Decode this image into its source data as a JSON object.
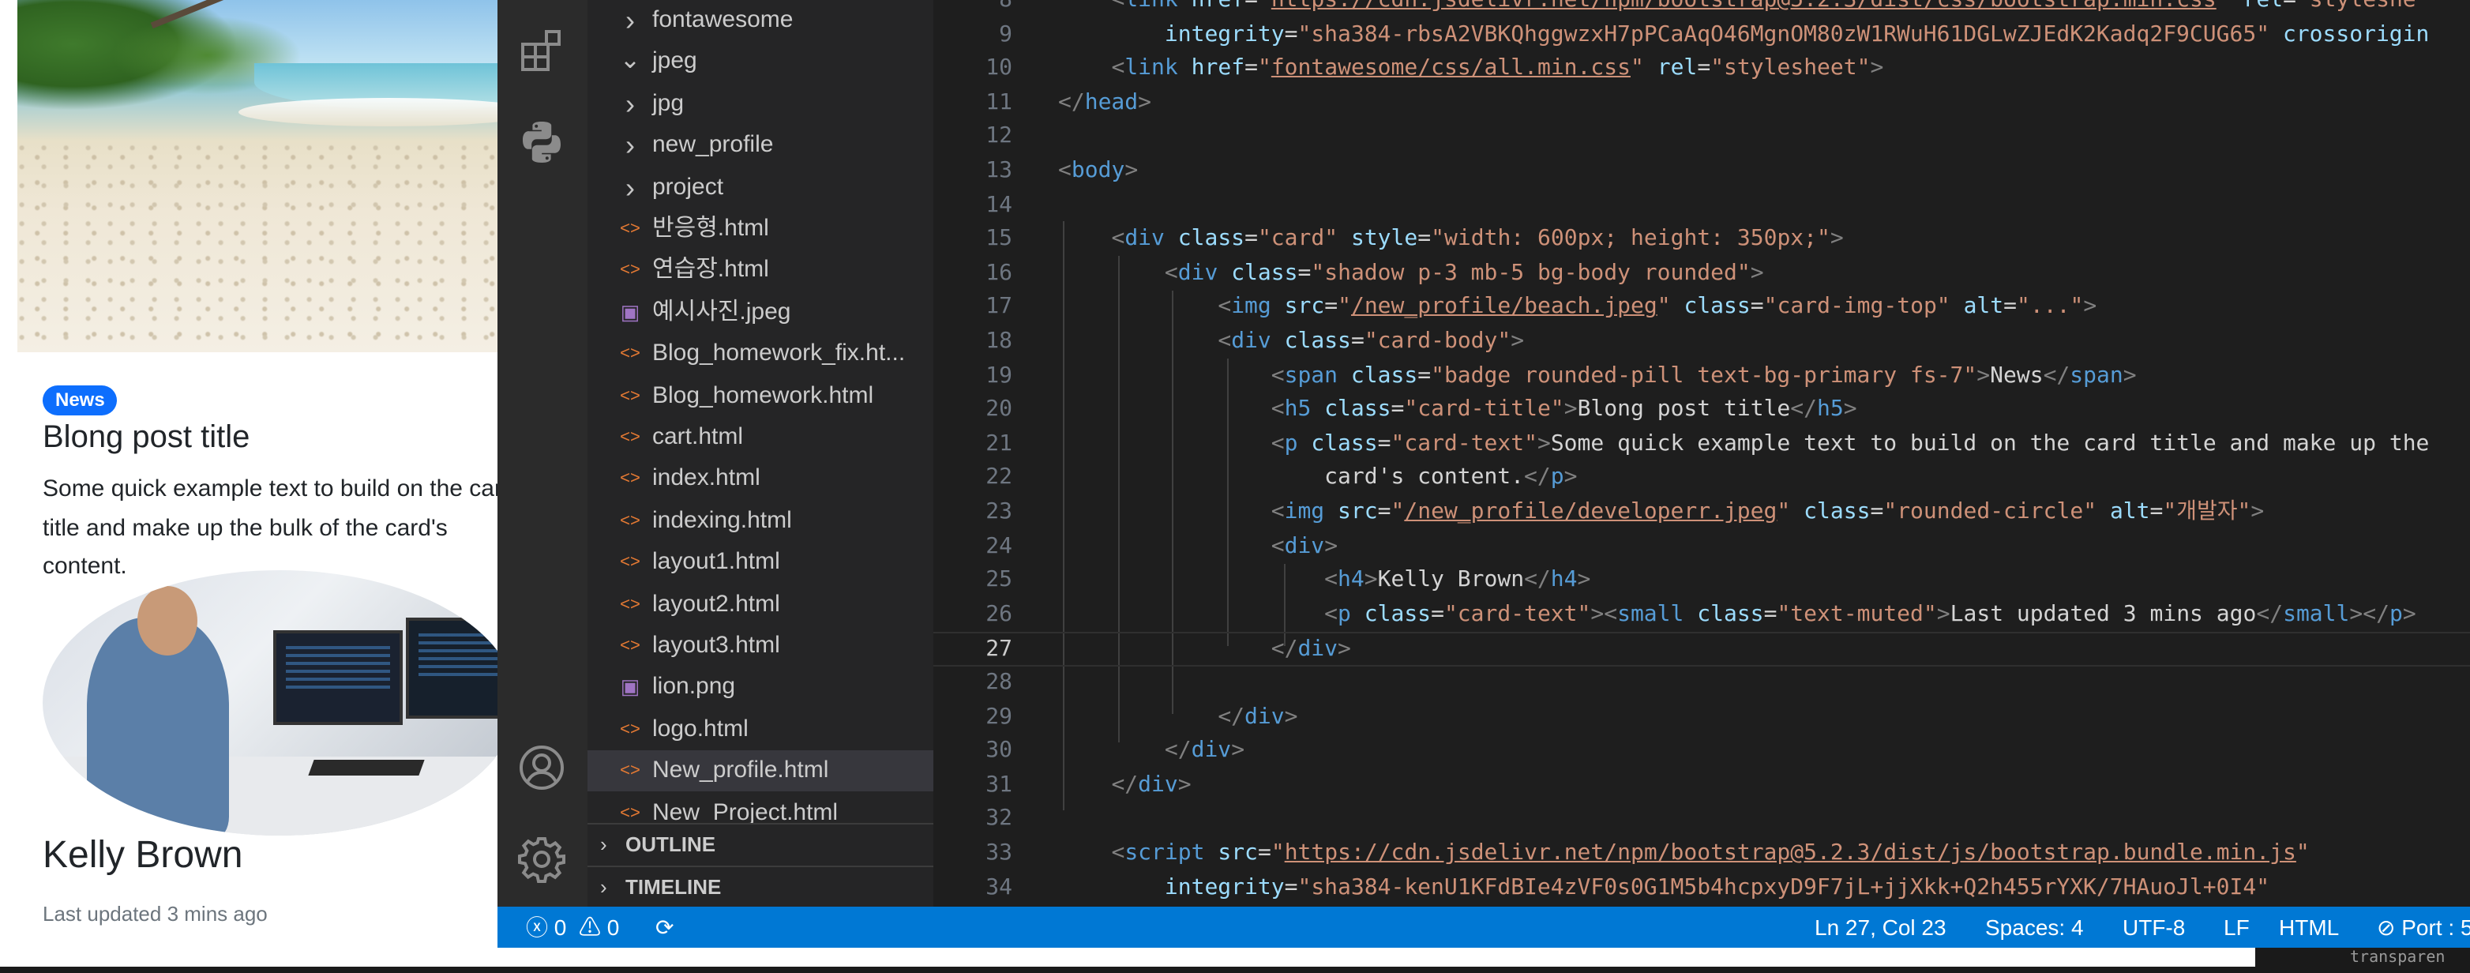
{
  "preview": {
    "badge": "News",
    "title": "Blong post title",
    "text": "Some quick example text to build on the card title and make up the bulk of the card's content.",
    "name": "Kelly Brown",
    "updated": "Last updated 3 mins ago"
  },
  "activity_icons": [
    "extensions-icon",
    "python-icon",
    "account-icon",
    "settings-gear-icon"
  ],
  "explorer": {
    "files": [
      {
        "label": "fontawesome",
        "type": "folder-closed"
      },
      {
        "label": "jpeg",
        "type": "folder-open"
      },
      {
        "label": "jpg",
        "type": "folder-closed"
      },
      {
        "label": "new_profile",
        "type": "folder-closed"
      },
      {
        "label": "project",
        "type": "folder-closed"
      },
      {
        "label": "반응형.html",
        "type": "html"
      },
      {
        "label": "연습장.html",
        "type": "html"
      },
      {
        "label": "예시사진.jpeg",
        "type": "image"
      },
      {
        "label": "Blog_homework_fix.ht...",
        "type": "html"
      },
      {
        "label": "Blog_homework.html",
        "type": "html"
      },
      {
        "label": "cart.html",
        "type": "html"
      },
      {
        "label": "index.html",
        "type": "html"
      },
      {
        "label": "indexing.html",
        "type": "html"
      },
      {
        "label": "layout1.html",
        "type": "html"
      },
      {
        "label": "layout2.html",
        "type": "html"
      },
      {
        "label": "layout3.html",
        "type": "html"
      },
      {
        "label": "lion.png",
        "type": "image"
      },
      {
        "label": "logo.html",
        "type": "html"
      },
      {
        "label": "New_profile.html",
        "type": "html",
        "selected": true
      },
      {
        "label": "New_Project.html",
        "type": "html"
      }
    ],
    "outline": "OUTLINE",
    "timeline": "TIMELINE"
  },
  "editor": {
    "current_line": 27,
    "lines": [
      {
        "n": "8",
        "segs": [
          [
            "i",
            "    "
          ],
          [
            "br",
            "<"
          ],
          [
            "tag",
            "link "
          ],
          [
            "attr",
            "href"
          ],
          [
            "eq",
            "="
          ],
          [
            "str",
            "\""
          ],
          [
            "url",
            "https://cdn.jsdelivr.net/npm/bootstrap@5.2.3/dist/css/bootstrap.min.css"
          ],
          [
            "str",
            "\""
          ],
          [
            "eq",
            " "
          ],
          [
            "attr",
            "rel"
          ],
          [
            "eq",
            "="
          ],
          [
            "str",
            "\"styleshe"
          ]
        ]
      },
      {
        "n": "9",
        "segs": [
          [
            "i",
            "        "
          ],
          [
            "attr",
            "integrity"
          ],
          [
            "eq",
            "="
          ],
          [
            "str",
            "\"sha384-rbsA2VBKQhggwzxH7pPCaAqO46MgnOM80zW1RWuH61DGLwZJEdK2Kadq2F9CUG65\""
          ],
          [
            "eq",
            " "
          ],
          [
            "attr",
            "crossorigin"
          ]
        ]
      },
      {
        "n": "10",
        "segs": [
          [
            "i",
            "    "
          ],
          [
            "br",
            "<"
          ],
          [
            "tag",
            "link "
          ],
          [
            "attr",
            "href"
          ],
          [
            "eq",
            "="
          ],
          [
            "str",
            "\""
          ],
          [
            "url",
            "fontawesome/css/all.min.css"
          ],
          [
            "str",
            "\""
          ],
          [
            "eq",
            " "
          ],
          [
            "attr",
            "rel"
          ],
          [
            "eq",
            "="
          ],
          [
            "str",
            "\"stylesheet\""
          ],
          [
            "br",
            ">"
          ]
        ]
      },
      {
        "n": "11",
        "segs": [
          [
            "br",
            "</"
          ],
          [
            "tag",
            "head"
          ],
          [
            "br",
            ">"
          ]
        ]
      },
      {
        "n": "12",
        "segs": []
      },
      {
        "n": "13",
        "segs": [
          [
            "br",
            "<"
          ],
          [
            "tag",
            "body"
          ],
          [
            "br",
            ">"
          ]
        ]
      },
      {
        "n": "14",
        "segs": []
      },
      {
        "n": "15",
        "segs": [
          [
            "i",
            "    "
          ],
          [
            "br",
            "<"
          ],
          [
            "tag",
            "div "
          ],
          [
            "attr",
            "class"
          ],
          [
            "eq",
            "="
          ],
          [
            "str",
            "\"card\""
          ],
          [
            "eq",
            " "
          ],
          [
            "attr",
            "style"
          ],
          [
            "eq",
            "="
          ],
          [
            "str",
            "\"width: 600px; height: 350px;\""
          ],
          [
            "br",
            ">"
          ]
        ]
      },
      {
        "n": "16",
        "segs": [
          [
            "i",
            "        "
          ],
          [
            "br",
            "<"
          ],
          [
            "tag",
            "div "
          ],
          [
            "attr",
            "class"
          ],
          [
            "eq",
            "="
          ],
          [
            "str",
            "\"shadow p-3 mb-5 bg-body rounded\""
          ],
          [
            "br",
            ">"
          ]
        ]
      },
      {
        "n": "17",
        "segs": [
          [
            "i",
            "            "
          ],
          [
            "br",
            "<"
          ],
          [
            "tag",
            "img "
          ],
          [
            "attr",
            "src"
          ],
          [
            "eq",
            "="
          ],
          [
            "str",
            "\""
          ],
          [
            "url",
            "/new_profile/beach.jpeg"
          ],
          [
            "str",
            "\""
          ],
          [
            "eq",
            " "
          ],
          [
            "attr",
            "class"
          ],
          [
            "eq",
            "="
          ],
          [
            "str",
            "\"card-img-top\""
          ],
          [
            "eq",
            " "
          ],
          [
            "attr",
            "alt"
          ],
          [
            "eq",
            "="
          ],
          [
            "str",
            "\"...\""
          ],
          [
            "br",
            ">"
          ]
        ]
      },
      {
        "n": "18",
        "segs": [
          [
            "i",
            "            "
          ],
          [
            "br",
            "<"
          ],
          [
            "tag",
            "div "
          ],
          [
            "attr",
            "class"
          ],
          [
            "eq",
            "="
          ],
          [
            "str",
            "\"card-body\""
          ],
          [
            "br",
            ">"
          ]
        ]
      },
      {
        "n": "19",
        "segs": [
          [
            "i",
            "                "
          ],
          [
            "br",
            "<"
          ],
          [
            "tag",
            "span "
          ],
          [
            "attr",
            "class"
          ],
          [
            "eq",
            "="
          ],
          [
            "str",
            "\"badge rounded-pill text-bg-primary fs-7\""
          ],
          [
            "br",
            ">"
          ],
          [
            "txt",
            "News"
          ],
          [
            "br",
            "</"
          ],
          [
            "tag",
            "span"
          ],
          [
            "br",
            ">"
          ]
        ]
      },
      {
        "n": "20",
        "segs": [
          [
            "i",
            "                "
          ],
          [
            "br",
            "<"
          ],
          [
            "tag",
            "h5 "
          ],
          [
            "attr",
            "class"
          ],
          [
            "eq",
            "="
          ],
          [
            "str",
            "\"card-title\""
          ],
          [
            "br",
            ">"
          ],
          [
            "txt",
            "Blong post title"
          ],
          [
            "br",
            "</"
          ],
          [
            "tag",
            "h5"
          ],
          [
            "br",
            ">"
          ]
        ]
      },
      {
        "n": "21",
        "segs": [
          [
            "i",
            "                "
          ],
          [
            "br",
            "<"
          ],
          [
            "tag",
            "p "
          ],
          [
            "attr",
            "class"
          ],
          [
            "eq",
            "="
          ],
          [
            "str",
            "\"card-text\""
          ],
          [
            "br",
            ">"
          ],
          [
            "txt",
            "Some quick example text to build on the card title and make up the"
          ]
        ]
      },
      {
        "n": "22",
        "segs": [
          [
            "i",
            "                    "
          ],
          [
            "txt",
            "card's content."
          ],
          [
            "br",
            "</"
          ],
          [
            "tag",
            "p"
          ],
          [
            "br",
            ">"
          ]
        ]
      },
      {
        "n": "23",
        "segs": [
          [
            "i",
            "                "
          ],
          [
            "br",
            "<"
          ],
          [
            "tag",
            "img "
          ],
          [
            "attr",
            "src"
          ],
          [
            "eq",
            "="
          ],
          [
            "str",
            "\""
          ],
          [
            "url",
            "/new_profile/developerr.jpeg"
          ],
          [
            "str",
            "\""
          ],
          [
            "eq",
            " "
          ],
          [
            "attr",
            "class"
          ],
          [
            "eq",
            "="
          ],
          [
            "str",
            "\"rounded-circle\""
          ],
          [
            "eq",
            " "
          ],
          [
            "attr",
            "alt"
          ],
          [
            "eq",
            "="
          ],
          [
            "str",
            "\"개발자\""
          ],
          [
            "br",
            ">"
          ]
        ]
      },
      {
        "n": "24",
        "segs": [
          [
            "i",
            "                "
          ],
          [
            "br",
            "<"
          ],
          [
            "tag",
            "div"
          ],
          [
            "br",
            ">"
          ]
        ]
      },
      {
        "n": "25",
        "segs": [
          [
            "i",
            "                    "
          ],
          [
            "br",
            "<"
          ],
          [
            "tag",
            "h4"
          ],
          [
            "br",
            ">"
          ],
          [
            "txt",
            "Kelly Brown"
          ],
          [
            "br",
            "</"
          ],
          [
            "tag",
            "h4"
          ],
          [
            "br",
            ">"
          ]
        ]
      },
      {
        "n": "26",
        "segs": [
          [
            "i",
            "                    "
          ],
          [
            "br",
            "<"
          ],
          [
            "tag",
            "p "
          ],
          [
            "attr",
            "class"
          ],
          [
            "eq",
            "="
          ],
          [
            "str",
            "\"card-text\""
          ],
          [
            "br",
            "><"
          ],
          [
            "tag",
            "small "
          ],
          [
            "attr",
            "class"
          ],
          [
            "eq",
            "="
          ],
          [
            "str",
            "\"text-muted\""
          ],
          [
            "br",
            ">"
          ],
          [
            "txt",
            "Last updated 3 mins ago"
          ],
          [
            "br",
            "</"
          ],
          [
            "tag",
            "small"
          ],
          [
            "br",
            "></"
          ],
          [
            "tag",
            "p"
          ],
          [
            "br",
            ">"
          ]
        ]
      },
      {
        "n": "27",
        "segs": [
          [
            "i",
            "                "
          ],
          [
            "br",
            "</"
          ],
          [
            "tag",
            "div"
          ],
          [
            "br",
            ">"
          ]
        ]
      },
      {
        "n": "28",
        "segs": []
      },
      {
        "n": "29",
        "segs": [
          [
            "i",
            "            "
          ],
          [
            "br",
            "</"
          ],
          [
            "tag",
            "div"
          ],
          [
            "br",
            ">"
          ]
        ]
      },
      {
        "n": "30",
        "segs": [
          [
            "i",
            "        "
          ],
          [
            "br",
            "</"
          ],
          [
            "tag",
            "div"
          ],
          [
            "br",
            ">"
          ]
        ]
      },
      {
        "n": "31",
        "segs": [
          [
            "i",
            "    "
          ],
          [
            "br",
            "</"
          ],
          [
            "tag",
            "div"
          ],
          [
            "br",
            ">"
          ]
        ]
      },
      {
        "n": "32",
        "segs": []
      },
      {
        "n": "33",
        "segs": [
          [
            "i",
            "    "
          ],
          [
            "br",
            "<"
          ],
          [
            "tag",
            "script "
          ],
          [
            "attr",
            "src"
          ],
          [
            "eq",
            "="
          ],
          [
            "str",
            "\""
          ],
          [
            "url",
            "https://cdn.jsdelivr.net/npm/bootstrap@5.2.3/dist/js/bootstrap.bundle.min.js"
          ],
          [
            "str",
            "\""
          ]
        ]
      },
      {
        "n": "34",
        "segs": [
          [
            "i",
            "        "
          ],
          [
            "attr",
            "integrity"
          ],
          [
            "eq",
            "="
          ],
          [
            "str",
            "\"sha384-kenU1KFdBIe4zVF0s0G1M5b4hcpxyD9F7jL+jjXkk+Q2h455rYXK/7HAuoJl+0I4\""
          ]
        ]
      }
    ]
  },
  "statusbar": {
    "errors": "0",
    "warnings": "0",
    "position": "Ln 27, Col 23",
    "spaces": "Spaces: 4",
    "encoding": "UTF-8",
    "eol": "LF",
    "language": "HTML",
    "port": "Port : 5"
  },
  "ghost_text": "transparen",
  "colors": {
    "statusbar": "#0078d4",
    "editor_bg": "#1e1e1e",
    "sidebar_bg": "#252526",
    "badge": "#0d6efd",
    "html_icon": "#e37933"
  }
}
